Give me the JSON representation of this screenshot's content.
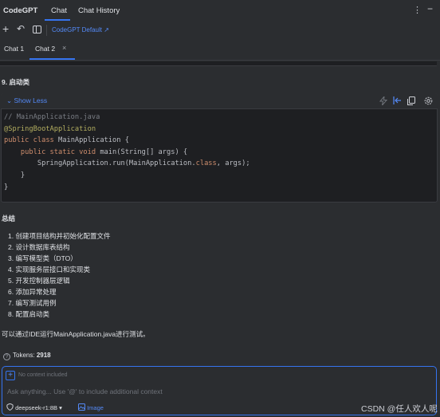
{
  "header": {
    "brand": "CodeGPT",
    "tabs": [
      "Chat",
      "Chat History"
    ],
    "active_tab": "Chat",
    "menu_icon": "⋮",
    "minimize_icon": "−"
  },
  "toolbar": {
    "new_chat_icon": "+",
    "undo_icon": "↶",
    "model_link": "CodeGPT Default ↗"
  },
  "chat_tabs": {
    "tabs": [
      "Chat 1",
      "Chat 2"
    ],
    "active": "Chat 2",
    "close_icon": "×"
  },
  "content": {
    "section_heading": "9. 启动类",
    "code_block": {
      "toggle_label": "Show Less",
      "toggle_icon": "⌄",
      "lines": [
        "// MainApplication.java",
        "@SpringBootApplication",
        "public class MainApplication {",
        "    public static void main(String[] args) {",
        "        SpringApplication.run(MainApplication.class, args);",
        "    }",
        "}"
      ]
    },
    "summary_heading": "总结",
    "steps": [
      "1. 创建项目结构并初始化配置文件",
      "2. 设计数据库表结构",
      "3. 编写模型类（DTO）",
      "4. 实现服务层接口和实现类",
      "5. 开发控制器层逻辑",
      "6. 添加异常处理",
      "7. 编写测试用例",
      "8. 配置启动类"
    ],
    "closing_text": "可以通过IDE运行MainApplication.java进行测试。"
  },
  "tokens": {
    "label": "Tokens:",
    "value": "2918"
  },
  "input": {
    "context_text": "No context included",
    "placeholder": "Ask anything... Use '@' to include additional context",
    "model": "deepseek-r1:8B",
    "image_label": "Image"
  },
  "watermark": "CSDN @任人欢人呢",
  "colors": {
    "accent": "#3574f0",
    "link": "#548af7",
    "background": "#2b2d30",
    "code_background": "#1e1f22"
  }
}
